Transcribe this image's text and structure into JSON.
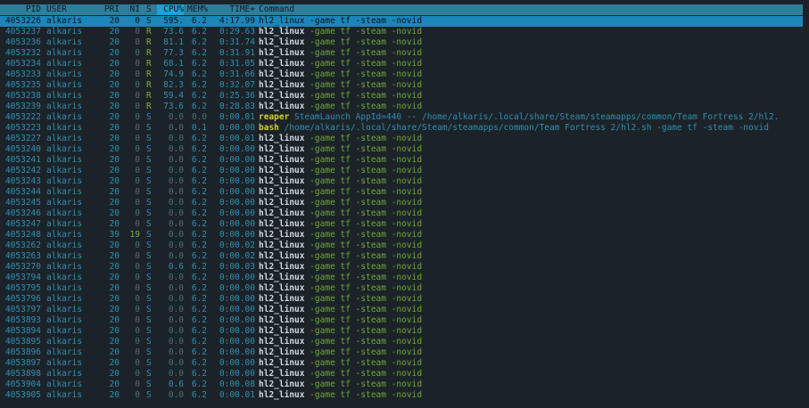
{
  "header": {
    "pid": "PID",
    "user": "USER",
    "pri": "PRI",
    "ni": "NI",
    "s": "S",
    "cpu": "CPU%",
    "mem": "MEM%",
    "time": "TIME+",
    "command": "Command"
  },
  "rows": [
    {
      "pid": "4053226",
      "user": "alkaris",
      "pri": "20",
      "ni": "0",
      "s": "S",
      "cpu": "595.",
      "mem": "6.2",
      "time": "4:17.99",
      "prog": "hl2_linux",
      "args": " -game tf -steam -novid",
      "selected": true
    },
    {
      "pid": "4053237",
      "user": "alkaris",
      "pri": "20",
      "ni": "0",
      "s": "R",
      "cpu": "73.6",
      "mem": "6.2",
      "time": "0:29.63",
      "prog": "hl2_linux",
      "args": " -game tf -steam -novid"
    },
    {
      "pid": "4053236",
      "user": "alkaris",
      "pri": "20",
      "ni": "0",
      "s": "R",
      "cpu": "81.1",
      "mem": "6.2",
      "time": "0:31.74",
      "prog": "hl2_linux",
      "args": " -game tf -steam -novid"
    },
    {
      "pid": "4053232",
      "user": "alkaris",
      "pri": "20",
      "ni": "0",
      "s": "R",
      "cpu": "77.3",
      "mem": "6.2",
      "time": "0:31.91",
      "prog": "hl2_linux",
      "args": " -game tf -steam -novid"
    },
    {
      "pid": "4053234",
      "user": "alkaris",
      "pri": "20",
      "ni": "0",
      "s": "R",
      "cpu": "68.1",
      "mem": "6.2",
      "time": "0:31.05",
      "prog": "hl2_linux",
      "args": " -game tf -steam -novid"
    },
    {
      "pid": "4053233",
      "user": "alkaris",
      "pri": "20",
      "ni": "0",
      "s": "R",
      "cpu": "74.9",
      "mem": "6.2",
      "time": "0:31.66",
      "prog": "hl2_linux",
      "args": " -game tf -steam -novid"
    },
    {
      "pid": "4053235",
      "user": "alkaris",
      "pri": "20",
      "ni": "0",
      "s": "R",
      "cpu": "82.3",
      "mem": "6.2",
      "time": "0:32.07",
      "prog": "hl2_linux",
      "args": " -game tf -steam -novid"
    },
    {
      "pid": "4053238",
      "user": "alkaris",
      "pri": "20",
      "ni": "0",
      "s": "R",
      "cpu": "59.4",
      "mem": "6.2",
      "time": "0:25.36",
      "prog": "hl2_linux",
      "args": " -game tf -steam -novid"
    },
    {
      "pid": "4053239",
      "user": "alkaris",
      "pri": "20",
      "ni": "0",
      "s": "R",
      "cpu": "73.6",
      "mem": "6.2",
      "time": "0:28.83",
      "prog": "hl2_linux",
      "args": " -game tf -steam -novid"
    },
    {
      "pid": "4053222",
      "user": "alkaris",
      "pri": "20",
      "ni": "0",
      "s": "S",
      "cpu": "0.0",
      "mem": "0.0",
      "time": "0:00.01",
      "prog": "reaper",
      "args": " SteamLaunch AppId=440 -- /home/alkaris/.local/share/Steam/steamapps/common/Team Fortress 2/hl2.",
      "progStyle": "y",
      "argsStyle": "b"
    },
    {
      "pid": "4053223",
      "user": "alkaris",
      "pri": "20",
      "ni": "0",
      "s": "S",
      "cpu": "0.0",
      "mem": "0.1",
      "time": "0:00.00",
      "prog": "bash",
      "args": " /home/alkaris/.local/share/Steam/steamapps/common/Team Fortress 2/hl2.sh -game tf -steam -novid",
      "progStyle": "y",
      "argsStyle": "b"
    },
    {
      "pid": "4053227",
      "user": "alkaris",
      "pri": "20",
      "ni": "0",
      "s": "S",
      "cpu": "0.0",
      "mem": "6.2",
      "time": "0:00.01",
      "prog": "hl2_linux",
      "args": " -game tf -steam -novid"
    },
    {
      "pid": "4053240",
      "user": "alkaris",
      "pri": "20",
      "ni": "0",
      "s": "S",
      "cpu": "0.0",
      "mem": "6.2",
      "time": "0:00.00",
      "prog": "hl2_linux",
      "args": " -game tf -steam -novid"
    },
    {
      "pid": "4053241",
      "user": "alkaris",
      "pri": "20",
      "ni": "0",
      "s": "S",
      "cpu": "0.0",
      "mem": "6.2",
      "time": "0:00.00",
      "prog": "hl2_linux",
      "args": " -game tf -steam -novid"
    },
    {
      "pid": "4053242",
      "user": "alkaris",
      "pri": "20",
      "ni": "0",
      "s": "S",
      "cpu": "0.0",
      "mem": "6.2",
      "time": "0:00.00",
      "prog": "hl2_linux",
      "args": " -game tf -steam -novid"
    },
    {
      "pid": "4053243",
      "user": "alkaris",
      "pri": "20",
      "ni": "0",
      "s": "S",
      "cpu": "0.0",
      "mem": "6.2",
      "time": "0:00.00",
      "prog": "hl2_linux",
      "args": " -game tf -steam -novid"
    },
    {
      "pid": "4053244",
      "user": "alkaris",
      "pri": "20",
      "ni": "0",
      "s": "S",
      "cpu": "0.0",
      "mem": "6.2",
      "time": "0:00.00",
      "prog": "hl2_linux",
      "args": " -game tf -steam -novid"
    },
    {
      "pid": "4053245",
      "user": "alkaris",
      "pri": "20",
      "ni": "0",
      "s": "S",
      "cpu": "0.0",
      "mem": "6.2",
      "time": "0:00.00",
      "prog": "hl2_linux",
      "args": " -game tf -steam -novid"
    },
    {
      "pid": "4053246",
      "user": "alkaris",
      "pri": "20",
      "ni": "0",
      "s": "S",
      "cpu": "0.0",
      "mem": "6.2",
      "time": "0:00.00",
      "prog": "hl2_linux",
      "args": " -game tf -steam -novid"
    },
    {
      "pid": "4053247",
      "user": "alkaris",
      "pri": "20",
      "ni": "0",
      "s": "S",
      "cpu": "0.0",
      "mem": "6.2",
      "time": "0:00.00",
      "prog": "hl2_linux",
      "args": " -game tf -steam -novid"
    },
    {
      "pid": "4053248",
      "user": "alkaris",
      "pri": "39",
      "ni": "19",
      "s": "S",
      "cpu": "0.0",
      "mem": "6.2",
      "time": "0:00.00",
      "prog": "hl2_linux",
      "args": " -game tf -steam -novid",
      "niHi": true
    },
    {
      "pid": "4053262",
      "user": "alkaris",
      "pri": "20",
      "ni": "0",
      "s": "S",
      "cpu": "0.0",
      "mem": "6.2",
      "time": "0:00.02",
      "prog": "hl2_linux",
      "args": " -game tf -steam -novid"
    },
    {
      "pid": "4053263",
      "user": "alkaris",
      "pri": "20",
      "ni": "0",
      "s": "S",
      "cpu": "0.0",
      "mem": "6.2",
      "time": "0:00.02",
      "prog": "hl2_linux",
      "args": " -game tf -steam -novid"
    },
    {
      "pid": "4053270",
      "user": "alkaris",
      "pri": "20",
      "ni": "0",
      "s": "S",
      "cpu": "0.6",
      "mem": "6.2",
      "time": "0:00.03",
      "prog": "hl2_linux",
      "args": " -game tf -steam -novid"
    },
    {
      "pid": "4053794",
      "user": "alkaris",
      "pri": "20",
      "ni": "0",
      "s": "S",
      "cpu": "0.0",
      "mem": "6.2",
      "time": "0:00.00",
      "prog": "hl2_linux",
      "args": " -game tf -steam -novid"
    },
    {
      "pid": "4053795",
      "user": "alkaris",
      "pri": "20",
      "ni": "0",
      "s": "S",
      "cpu": "0.0",
      "mem": "6.2",
      "time": "0:00.00",
      "prog": "hl2_linux",
      "args": " -game tf -steam -novid"
    },
    {
      "pid": "4053796",
      "user": "alkaris",
      "pri": "20",
      "ni": "0",
      "s": "S",
      "cpu": "0.0",
      "mem": "6.2",
      "time": "0:00.00",
      "prog": "hl2_linux",
      "args": " -game tf -steam -novid"
    },
    {
      "pid": "4053797",
      "user": "alkaris",
      "pri": "20",
      "ni": "0",
      "s": "S",
      "cpu": "0.0",
      "mem": "6.2",
      "time": "0:00.00",
      "prog": "hl2_linux",
      "args": " -game tf -steam -novid"
    },
    {
      "pid": "4053893",
      "user": "alkaris",
      "pri": "20",
      "ni": "0",
      "s": "S",
      "cpu": "0.0",
      "mem": "6.2",
      "time": "0:00.00",
      "prog": "hl2_linux",
      "args": " -game tf -steam -novid"
    },
    {
      "pid": "4053894",
      "user": "alkaris",
      "pri": "20",
      "ni": "0",
      "s": "S",
      "cpu": "0.0",
      "mem": "6.2",
      "time": "0:00.00",
      "prog": "hl2_linux",
      "args": " -game tf -steam -novid"
    },
    {
      "pid": "4053895",
      "user": "alkaris",
      "pri": "20",
      "ni": "0",
      "s": "S",
      "cpu": "0.0",
      "mem": "6.2",
      "time": "0:00.00",
      "prog": "hl2_linux",
      "args": " -game tf -steam -novid"
    },
    {
      "pid": "4053896",
      "user": "alkaris",
      "pri": "20",
      "ni": "0",
      "s": "S",
      "cpu": "0.0",
      "mem": "6.2",
      "time": "0:00.00",
      "prog": "hl2_linux",
      "args": " -game tf -steam -novid"
    },
    {
      "pid": "4053897",
      "user": "alkaris",
      "pri": "20",
      "ni": "0",
      "s": "S",
      "cpu": "0.0",
      "mem": "6.2",
      "time": "0:00.00",
      "prog": "hl2_linux",
      "args": " -game tf -steam -novid"
    },
    {
      "pid": "4053898",
      "user": "alkaris",
      "pri": "20",
      "ni": "0",
      "s": "S",
      "cpu": "0.0",
      "mem": "6.2",
      "time": "0:00.00",
      "prog": "hl2_linux",
      "args": " -game tf -steam -novid"
    },
    {
      "pid": "4053904",
      "user": "alkaris",
      "pri": "20",
      "ni": "0",
      "s": "S",
      "cpu": "0.6",
      "mem": "6.2",
      "time": "0:00.08",
      "prog": "hl2_linux",
      "args": " -game tf -steam -novid"
    },
    {
      "pid": "4053905",
      "user": "alkaris",
      "pri": "20",
      "ni": "0",
      "s": "S",
      "cpu": "0.0",
      "mem": "6.2",
      "time": "0:00.01",
      "prog": "hl2_linux",
      "args": " -game tf -steam -novid"
    }
  ]
}
